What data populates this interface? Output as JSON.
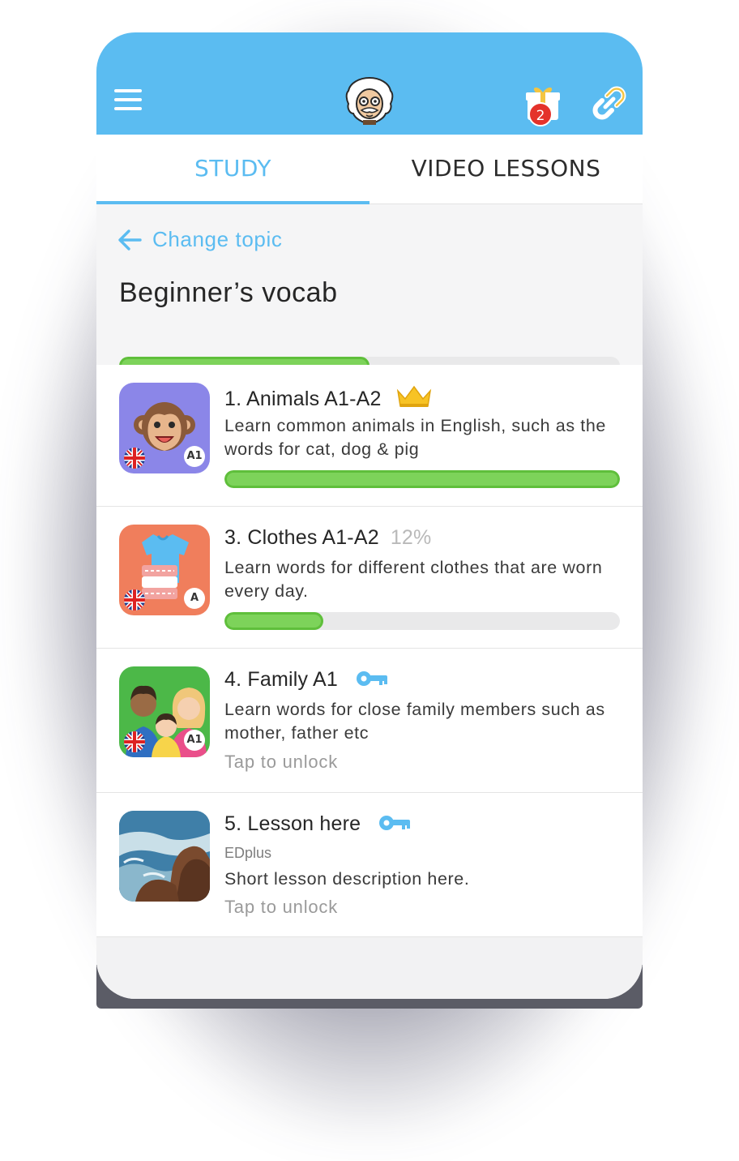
{
  "app": {
    "gift_count": "2",
    "accent_color": "#5bbcf1",
    "progress_color": "#7dd35a"
  },
  "icons": {
    "menu": "menu-icon",
    "mascot": "einstein-mascot-icon",
    "gift": "gift-icon",
    "link": "link-icon",
    "back": "arrow-left-icon",
    "crown": "crown-icon",
    "key": "key-icon",
    "flag": "uk-flag-icon"
  },
  "tabs": [
    {
      "label": "STUDY",
      "active": true
    },
    {
      "label": "VIDEO LESSONS",
      "active": false
    }
  ],
  "topic": {
    "back_label": "Change topic",
    "title": "Beginner’s vocab",
    "progress": 0.5
  },
  "lessons": [
    {
      "title": "1. Animals  A1-A2",
      "description": "Learn common animals in English, such as the words for cat, dog & pig",
      "level": "A1",
      "progress": 1.0,
      "status": "completed"
    },
    {
      "title": "3. Clothes A1-A2",
      "percent": "12%",
      "description": "Learn words for different clothes that are worn every day.",
      "level": "A",
      "progress": 0.25,
      "status": "in-progress"
    },
    {
      "title": "4. Family A1",
      "description": "Learn words for close family members such as mother, father etc",
      "level": "A1",
      "unlock": "Tap to unlock",
      "status": "locked"
    },
    {
      "title": "5. Lesson here",
      "author": "EDplus",
      "description": "Short lesson description here.",
      "unlock": "Tap to unlock",
      "status": "locked"
    }
  ]
}
